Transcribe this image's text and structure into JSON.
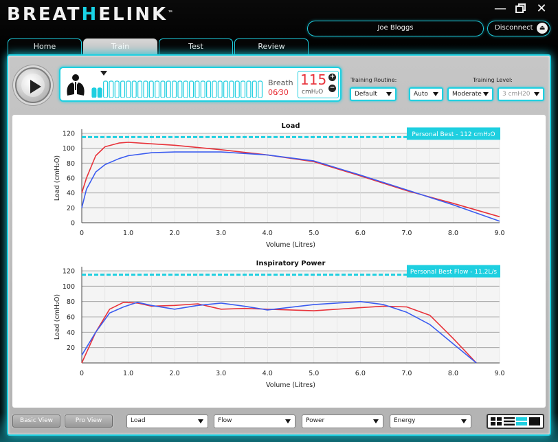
{
  "app": {
    "brand_parts": [
      "BREAT",
      "H",
      "ELINK"
    ],
    "trademark": "™",
    "user_name": "Joe Bloggs",
    "disconnect_label": "Disconnect",
    "colors": {
      "accent": "#1ecfe0",
      "series_red": "#e8323a",
      "series_blue": "#3b5cf0",
      "personal_best": "#1ecfe0"
    }
  },
  "tabs": [
    {
      "label": "Home",
      "active": false
    },
    {
      "label": "Train",
      "active": true
    },
    {
      "label": "Test",
      "active": false
    },
    {
      "label": "Review",
      "active": false
    }
  ],
  "session": {
    "breath_label": "Breath",
    "breath_count": "06⁄30",
    "load_value": "115",
    "load_unit": "cmH₂O",
    "progress_bars": 30,
    "completed_bars": 2
  },
  "controls": {
    "routine_label": "Training Routine:",
    "routine_value": "Default",
    "level_label": "Training Level:",
    "auto_value": "Auto",
    "level_value": "Moderate",
    "step_value": "3 cmH20"
  },
  "bottom": {
    "basic_view": "Basic View",
    "pro_view": "Pro View",
    "selectors": [
      "Load",
      "Flow",
      "Power",
      "Energy"
    ]
  },
  "chart_data": [
    {
      "type": "line",
      "title": "Load",
      "xlabel": "Volume (Litres)",
      "ylabel": "Load (cmH₂O)",
      "xlim": [
        0,
        9
      ],
      "ylim": [
        0,
        120
      ],
      "xticks": [
        "0",
        "1.0",
        "2.0",
        "3.0",
        "4.0",
        "5.0",
        "6.0",
        "7.0",
        "8.0",
        "9.0"
      ],
      "yticks": [
        "0",
        "20",
        "40",
        "60",
        "80",
        "100",
        "120"
      ],
      "grid": true,
      "personal_best": {
        "label": "Personal Best - 112 cmH₂O",
        "y": 115
      },
      "series": [
        {
          "color": "red",
          "x": [
            0,
            0.1,
            0.3,
            0.5,
            0.8,
            1.0,
            1.5,
            2.0,
            3.0,
            4.0,
            5.0,
            6.0,
            7.0,
            8.0,
            9.0
          ],
          "y": [
            40,
            60,
            90,
            102,
            107,
            108,
            106,
            104,
            98,
            91,
            82,
            63,
            43,
            26,
            8
          ]
        },
        {
          "color": "blue",
          "x": [
            0,
            0.1,
            0.3,
            0.5,
            0.8,
            1.0,
            1.5,
            2.0,
            3.0,
            4.0,
            5.0,
            6.0,
            7.0,
            8.0,
            9.0
          ],
          "y": [
            20,
            45,
            68,
            78,
            86,
            90,
            94,
            95,
            95,
            91,
            83,
            64,
            44,
            24,
            2
          ]
        }
      ]
    },
    {
      "type": "line",
      "title": "Inspiratory Power",
      "xlabel": "Volume (Litres)",
      "ylabel": "Load (cmH₂O)",
      "xlim": [
        0,
        9
      ],
      "ylim": [
        0,
        120
      ],
      "xticks": [
        "0",
        "1.0",
        "2.0",
        "3.0",
        "4.0",
        "5.0",
        "6.0",
        "7.0",
        "8.0",
        "9.0"
      ],
      "yticks": [
        "20",
        "40",
        "60",
        "80",
        "100",
        "120"
      ],
      "grid": true,
      "personal_best": {
        "label": "Personal Best Flow - 11.2L/s",
        "y": 115
      },
      "series": [
        {
          "color": "red",
          "x": [
            0,
            0.3,
            0.6,
            0.9,
            1.2,
            1.5,
            2.0,
            2.5,
            3.0,
            3.5,
            4.0,
            5.0,
            6.0,
            6.5,
            7.0,
            7.5,
            8.0,
            8.5
          ],
          "y": [
            0,
            40,
            70,
            79,
            78,
            74,
            75,
            77,
            70,
            71,
            70,
            68,
            72,
            74,
            73,
            62,
            32,
            0
          ]
        },
        {
          "color": "blue",
          "x": [
            0,
            0.3,
            0.6,
            0.9,
            1.2,
            1.5,
            2.0,
            2.5,
            3.0,
            3.5,
            4.0,
            5.0,
            6.0,
            6.5,
            7.0,
            7.5,
            8.0,
            8.5
          ],
          "y": [
            10,
            40,
            65,
            73,
            79,
            75,
            70,
            75,
            78,
            74,
            69,
            76,
            80,
            76,
            66,
            50,
            25,
            0
          ]
        }
      ]
    }
  ]
}
